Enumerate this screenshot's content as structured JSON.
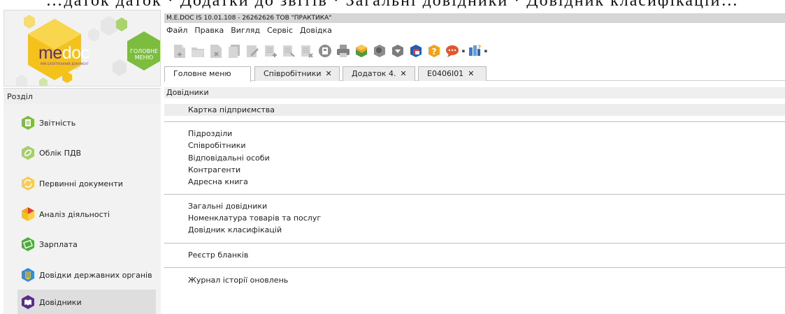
{
  "top_strip_text": "…даток   даток  ·  Додатки  до  звітів  ·  Загальні  довідники  ·  Довідник  класифікацій…",
  "logo": {
    "me": "me",
    "doc": "doc",
    "subtitle": "МІЙ ЕЛЕКТРОННИЙ ДОКУМЕНТ",
    "badge": "ГОЛОВНЕ МЕНЮ",
    "colors": {
      "yellow": "#f4c21b",
      "green": "#7cbc3f",
      "purple": "#5a2d8c"
    }
  },
  "titlebar": "M.E.DOC IS 10.01.108 - 26262626 ТОВ \"ПРАКТИКА\"",
  "menu": [
    "Файл",
    "Правка",
    "Вигляд",
    "Сервіс",
    "Довідка"
  ],
  "toolbar_icons": [
    "add-document-icon",
    "open-document-icon",
    "delete-document-icon",
    "copy-document-icon",
    "edit-document-icon",
    "add-row-icon",
    "find-row-icon",
    "delete-row-icon",
    "view-icon",
    "print-icon",
    "send-icon",
    "search-settings-icon",
    "shield-icon",
    "sync-icon",
    "help-icon",
    "chat-icon",
    "info-icon"
  ],
  "tabs": [
    {
      "label": "Головне меню",
      "closable": false,
      "active": true
    },
    {
      "label": "Співробітники",
      "closable": true,
      "active": false
    },
    {
      "label": "Додаток 4.",
      "closable": true,
      "active": false
    },
    {
      "label": "E0406I01",
      "closable": true,
      "active": false
    }
  ],
  "close_glyph": "✕",
  "sidebar": {
    "header": "Розділ",
    "items": [
      {
        "label": "Звітність",
        "icon": "report-icon",
        "active": false
      },
      {
        "label": "Облік ПДВ",
        "icon": "vat-icon",
        "active": false
      },
      {
        "label": "Первинні документи",
        "icon": "primary-docs-icon",
        "active": false
      },
      {
        "label": "Аналіз діяльності",
        "icon": "analysis-icon",
        "active": false
      },
      {
        "label": "Зарплата",
        "icon": "salary-icon",
        "active": false
      },
      {
        "label": "Довідки державних органів",
        "icon": "state-certificates-icon",
        "active": false
      },
      {
        "label": "Довідники",
        "icon": "directories-icon",
        "active": true
      }
    ]
  },
  "content": {
    "header": "Довідники",
    "groups": [
      [
        "Картка підприємства"
      ],
      [
        "Підрозділи",
        "Співробітники",
        "Відповідальні особи",
        "Контрагенти",
        "Адресна книга"
      ],
      [
        "Загальні довідники",
        "Номенклатура товарів та послуг",
        "Довідник класифікацій"
      ],
      [
        "Реєстр бланків"
      ],
      [
        "Журнал історії оновлень"
      ]
    ]
  }
}
